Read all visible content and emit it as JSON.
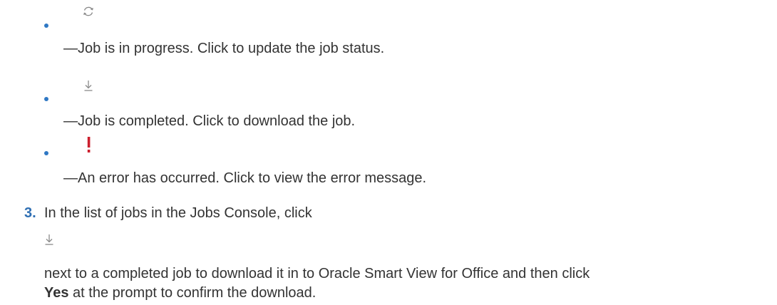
{
  "status_list": {
    "items": [
      {
        "icon": "refresh-icon",
        "text": "—Job is in progress. Click to update the job status."
      },
      {
        "icon": "download-icon",
        "text": "—Job is completed. Click to download the job."
      },
      {
        "icon": "error-exclamation-icon",
        "text": "—An error has occurred. Click to view the error message.",
        "icon_color": "#cc1f2d"
      }
    ]
  },
  "step3": {
    "number": "3.",
    "intro": "In the list of jobs in the Jobs Console, click",
    "icon": "download-icon",
    "line1": "next to a completed job to download it in to Oracle Smart View for Office and then click",
    "bold": "Yes",
    "line2_rest": " at the prompt to confirm the download."
  },
  "colors": {
    "text": "#333333",
    "bullet": "#2f78c4",
    "step_number": "#2f6fb3",
    "icon_gray": "#8a8a8a",
    "error_red": "#cc1f2d"
  }
}
